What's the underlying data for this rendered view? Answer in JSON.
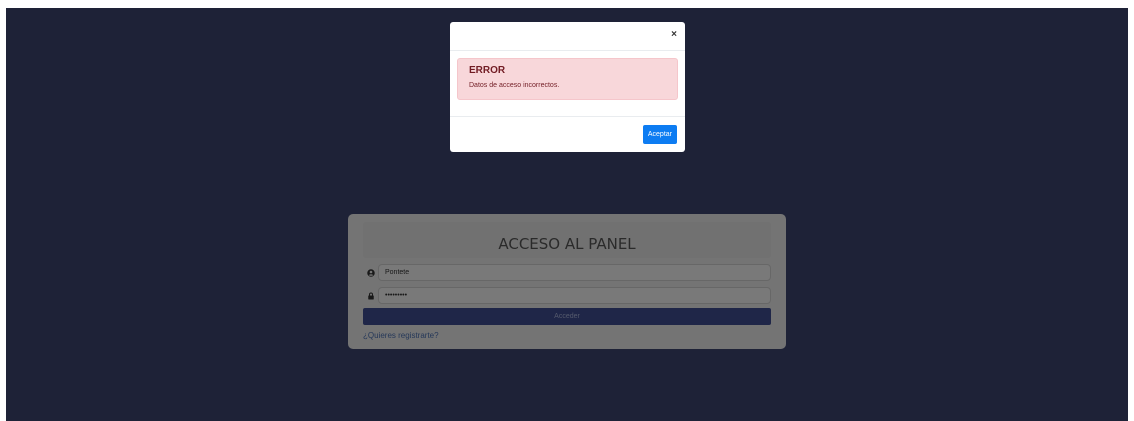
{
  "login": {
    "title": "ACCESO AL PANEL",
    "username_value": "Pontete",
    "password_value": "•••••••••",
    "submit_label": "Acceder",
    "register_link": "¿Quieres registrarte?"
  },
  "modal": {
    "close_symbol": "×",
    "alert_title": "ERROR",
    "alert_message": "Datos de acceso incorrectos.",
    "accept_label": "Aceptar"
  },
  "icons": {
    "user": "user-circle-icon",
    "password": "lock-icon"
  },
  "colors": {
    "background": "#3c456f",
    "alert_bg": "#f8d7da",
    "alert_text": "#721c24",
    "primary": "#0d7cf2"
  }
}
